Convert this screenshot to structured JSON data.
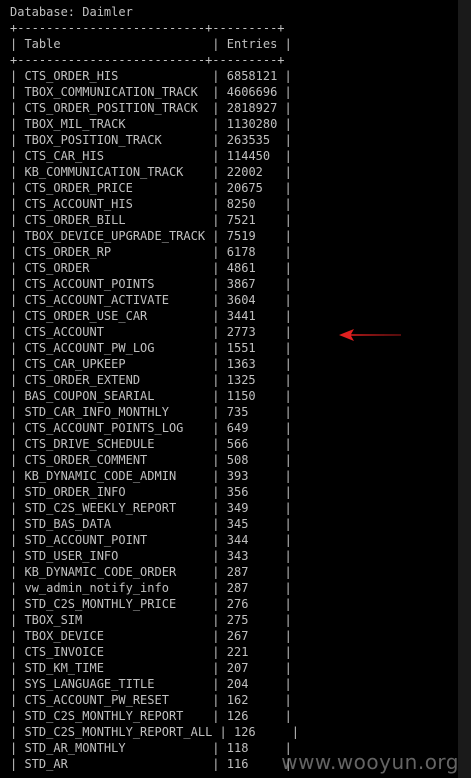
{
  "database_line": "Database: Daimler",
  "border_line": "+--------------------------+---------+",
  "table": {
    "headers": [
      "Table",
      "Entries"
    ],
    "rows": [
      [
        "CTS_ORDER_HIS",
        "6858121"
      ],
      [
        "TBOX_COMMUNICATION_TRACK",
        "4606696"
      ],
      [
        "CTS_ORDER_POSITION_TRACK",
        "2818927"
      ],
      [
        "TBOX_MIL_TRACK",
        "1130280"
      ],
      [
        "TBOX_POSITION_TRACK",
        "263535"
      ],
      [
        "CTS_CAR_HIS",
        "114450"
      ],
      [
        "KB_COMMUNICATION_TRACK",
        "22002"
      ],
      [
        "CTS_ORDER_PRICE",
        "20675"
      ],
      [
        "CTS_ACCOUNT_HIS",
        "8250"
      ],
      [
        "CTS_ORDER_BILL",
        "7521"
      ],
      [
        "TBOX_DEVICE_UPGRADE_TRACK",
        "7519"
      ],
      [
        "CTS_ORDER_RP",
        "6178"
      ],
      [
        "CTS_ORDER",
        "4861"
      ],
      [
        "CTS_ACCOUNT_POINTS",
        "3867"
      ],
      [
        "CTS_ACCOUNT_ACTIVATE",
        "3604"
      ],
      [
        "CTS_ORDER_USE_CAR",
        "3441"
      ],
      [
        "CTS_ACCOUNT",
        "2773"
      ],
      [
        "CTS_ACCOUNT_PW_LOG",
        "1551"
      ],
      [
        "CTS_CAR_UPKEEP",
        "1363"
      ],
      [
        "CTS_ORDER_EXTEND",
        "1325"
      ],
      [
        "BAS_COUPON_SEARIAL",
        "1150"
      ],
      [
        "STD_CAR_INFO_MONTHLY",
        "735"
      ],
      [
        "CTS_ACCOUNT_POINTS_LOG",
        "649"
      ],
      [
        "CTS_DRIVE_SCHEDULE",
        "566"
      ],
      [
        "CTS_ORDER_COMMENT",
        "508"
      ],
      [
        "KB_DYNAMIC_CODE_ADMIN",
        "393"
      ],
      [
        "STD_ORDER_INFO",
        "356"
      ],
      [
        "STD_C2S_WEEKLY_REPORT",
        "349"
      ],
      [
        "STD_BAS_DATA",
        "345"
      ],
      [
        "STD_ACCOUNT_POINT",
        "344"
      ],
      [
        "STD_USER_INFO",
        "343"
      ],
      [
        "KB_DYNAMIC_CODE_ORDER",
        "287"
      ],
      [
        "vw_admin_notify_info",
        "287"
      ],
      [
        "STD_C2S_MONTHLY_PRICE",
        "276"
      ],
      [
        "TBOX_SIM",
        "275"
      ],
      [
        "TBOX_DEVICE",
        "267"
      ],
      [
        "CTS_INVOICE",
        "221"
      ],
      [
        "STD_KM_TIME",
        "207"
      ],
      [
        "SYS_LANGUAGE_TITLE",
        "204"
      ],
      [
        "CTS_ACCOUNT_PW_RESET",
        "162"
      ],
      [
        "STD_C2S_MONTHLY_REPORT",
        "126"
      ],
      [
        "STD_C2S_MONTHLY_REPORT_ALL",
        "126"
      ],
      [
        "STD_AR_MONTHLY",
        "118"
      ],
      [
        "STD_AR",
        "116"
      ]
    ]
  },
  "annotation": {
    "arrow_color": "#e02020",
    "arrow_points_to_row": "CTS_ACCOUNT"
  },
  "watermark": "www.wooyun.org",
  "colors": {
    "background": "#000000",
    "text": "#c0c0c0"
  }
}
